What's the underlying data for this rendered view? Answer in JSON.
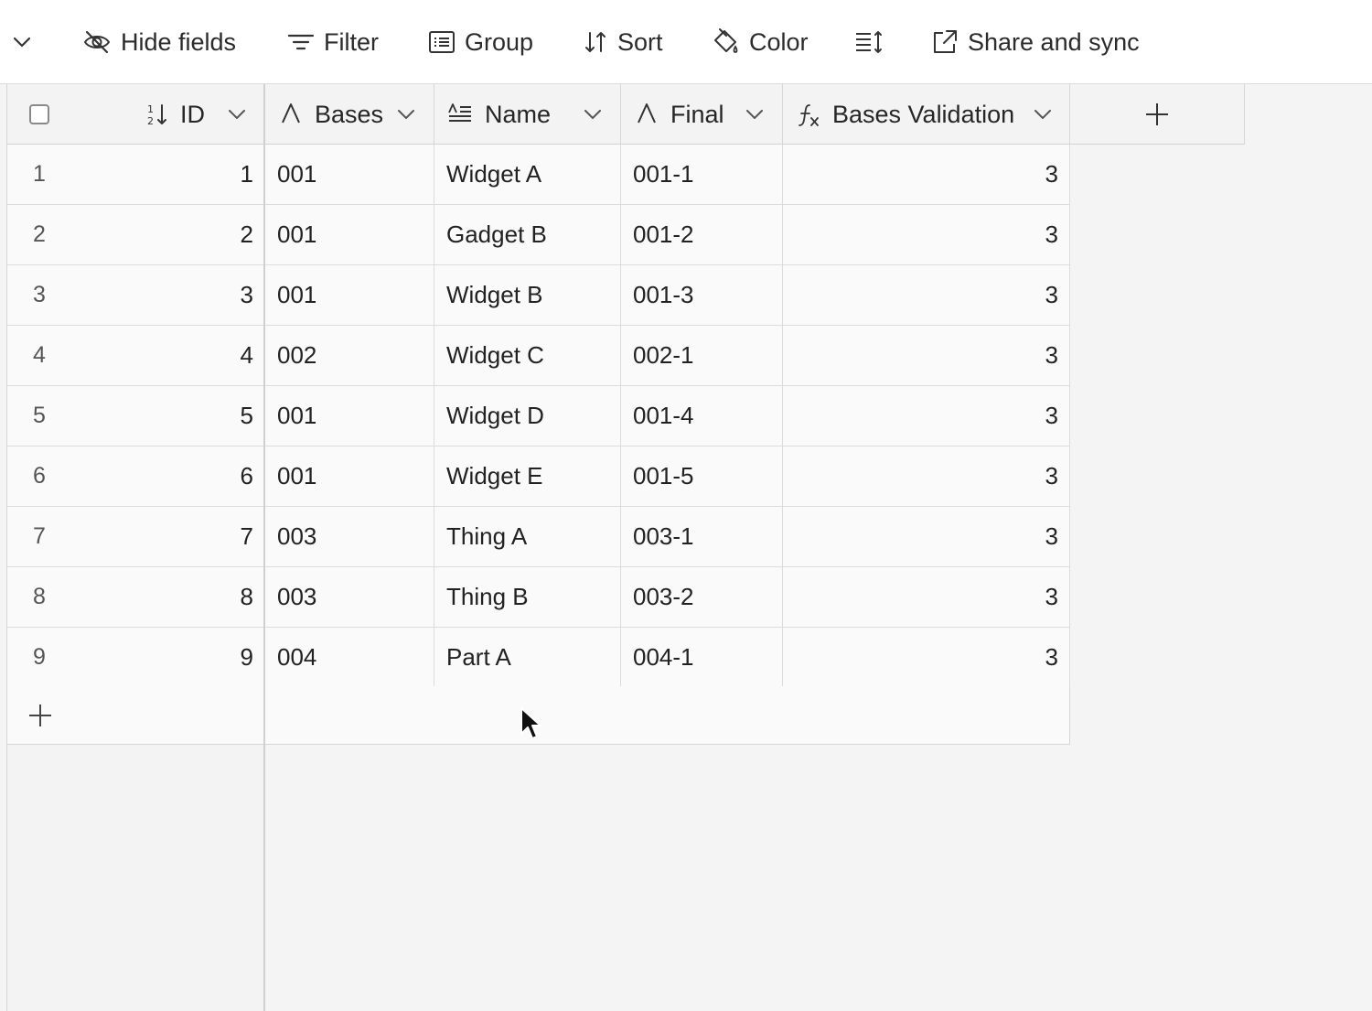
{
  "toolbar": {
    "items": [
      {
        "label": "Hide fields",
        "icon": "eye-slash-icon"
      },
      {
        "label": "Filter",
        "icon": "filter-icon"
      },
      {
        "label": "Group",
        "icon": "group-icon"
      },
      {
        "label": "Sort",
        "icon": "sort-icon"
      },
      {
        "label": "Color",
        "icon": "paint-bucket-icon"
      },
      {
        "label": "",
        "icon": "row-height-icon"
      },
      {
        "label": "Share and sync",
        "icon": "share-external-icon"
      }
    ]
  },
  "columns": [
    {
      "label": "ID",
      "icon": "autonumber-icon"
    },
    {
      "label": "Bases",
      "icon": "single-line-text-icon"
    },
    {
      "label": "Name",
      "icon": "long-text-icon"
    },
    {
      "label": "Final",
      "icon": "single-line-text-icon"
    },
    {
      "label": "Bases Validation",
      "icon": "formula-icon"
    }
  ],
  "rows": [
    {
      "num": "1",
      "id": "1",
      "bases": "001",
      "name": "Widget A",
      "final": "001-1",
      "validation": "3"
    },
    {
      "num": "2",
      "id": "2",
      "bases": "001",
      "name": "Gadget B",
      "final": "001-2",
      "validation": "3"
    },
    {
      "num": "3",
      "id": "3",
      "bases": "001",
      "name": "Widget B",
      "final": "001-3",
      "validation": "3"
    },
    {
      "num": "4",
      "id": "4",
      "bases": "002",
      "name": "Widget C",
      "final": "002-1",
      "validation": "3"
    },
    {
      "num": "5",
      "id": "5",
      "bases": "001",
      "name": "Widget D",
      "final": "001-4",
      "validation": "3"
    },
    {
      "num": "6",
      "id": "6",
      "bases": "001",
      "name": "Widget E",
      "final": "001-5",
      "validation": "3"
    },
    {
      "num": "7",
      "id": "7",
      "bases": "003",
      "name": "Thing A",
      "final": "003-1",
      "validation": "3"
    },
    {
      "num": "8",
      "id": "8",
      "bases": "003",
      "name": "Thing B",
      "final": "003-2",
      "validation": "3"
    },
    {
      "num": "9",
      "id": "9",
      "bases": "004",
      "name": "Part A",
      "final": "004-1",
      "validation": "3"
    }
  ]
}
